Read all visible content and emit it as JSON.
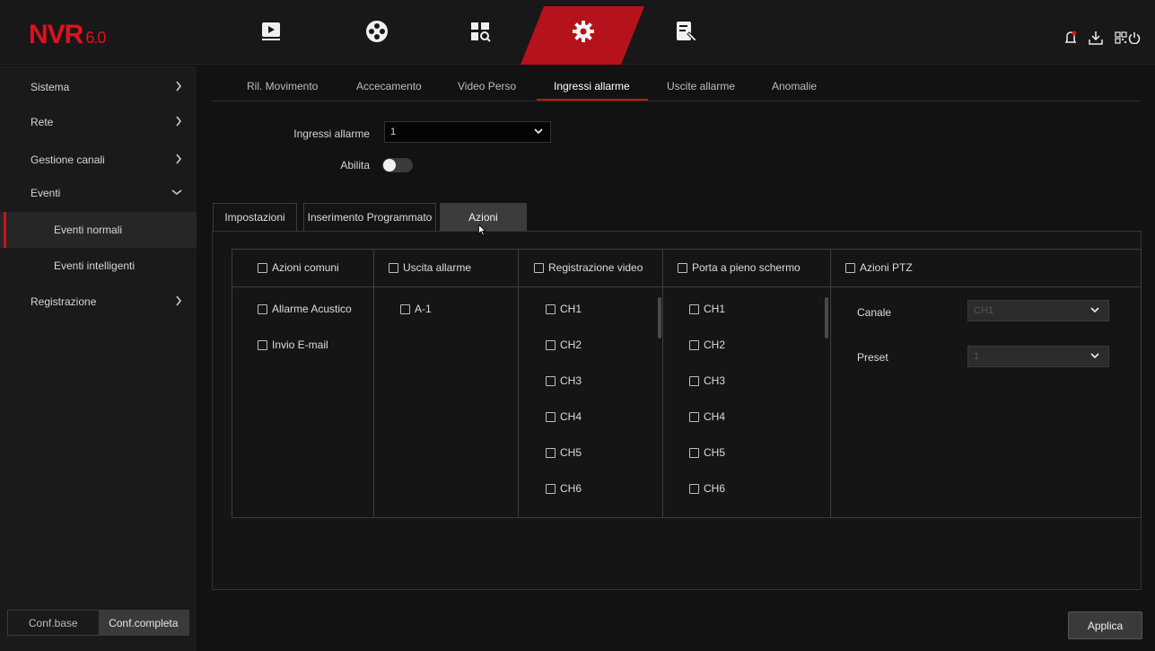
{
  "app": {
    "logo": "NVR",
    "version": "6.0"
  },
  "topnav": {
    "items": [
      {
        "name": "playback-icon"
      },
      {
        "name": "film-reel-icon"
      },
      {
        "name": "ai-search-icon"
      },
      {
        "name": "settings-gear-icon",
        "active": true
      },
      {
        "name": "maintenance-icon"
      }
    ],
    "right_icons": [
      "alarm-bell-icon",
      "download-icon",
      "qr-code-icon",
      "power-icon"
    ],
    "accent_color": "#b5121b"
  },
  "sidebar": {
    "items": [
      {
        "label": "Sistema"
      },
      {
        "label": "Rete"
      },
      {
        "label": "Gestione canali"
      },
      {
        "label": "Eventi"
      },
      {
        "label": "Eventi normali"
      },
      {
        "label": "Eventi intelligenti"
      },
      {
        "label": "Registrazione"
      }
    ],
    "conf_base": "Conf.base",
    "conf_full": "Conf.completa"
  },
  "tabs": [
    "Ril. Movimento",
    "Accecamento",
    "Video Perso",
    "Ingressi allarme",
    "Uscite allarme",
    "Anomalie"
  ],
  "form": {
    "input_label": "Ingressi allarme",
    "input_value": "1",
    "enable_label": "Abilita",
    "enable_on": false
  },
  "subtabs": [
    "Impostazioni",
    "Inserimento Programmato",
    "Azioni"
  ],
  "actions": {
    "common": {
      "header": "Azioni comuni",
      "items": [
        "Allarme Acustico",
        "Invio E-mail"
      ]
    },
    "alarm_out": {
      "header": "Uscita allarme",
      "items": [
        "A-1"
      ]
    },
    "record": {
      "header": "Registrazione video",
      "items": [
        "CH1",
        "CH2",
        "CH3",
        "CH4",
        "CH5",
        "CH6"
      ]
    },
    "fullscreen": {
      "header": "Porta a pieno schermo",
      "items": [
        "CH1",
        "CH2",
        "CH3",
        "CH4",
        "CH5",
        "CH6"
      ]
    },
    "ptz": {
      "header": "Azioni PTZ",
      "channel_label": "Canale",
      "channel_value": "CH1",
      "preset_label": "Preset",
      "preset_value": "1"
    }
  },
  "apply_label": "Applica"
}
